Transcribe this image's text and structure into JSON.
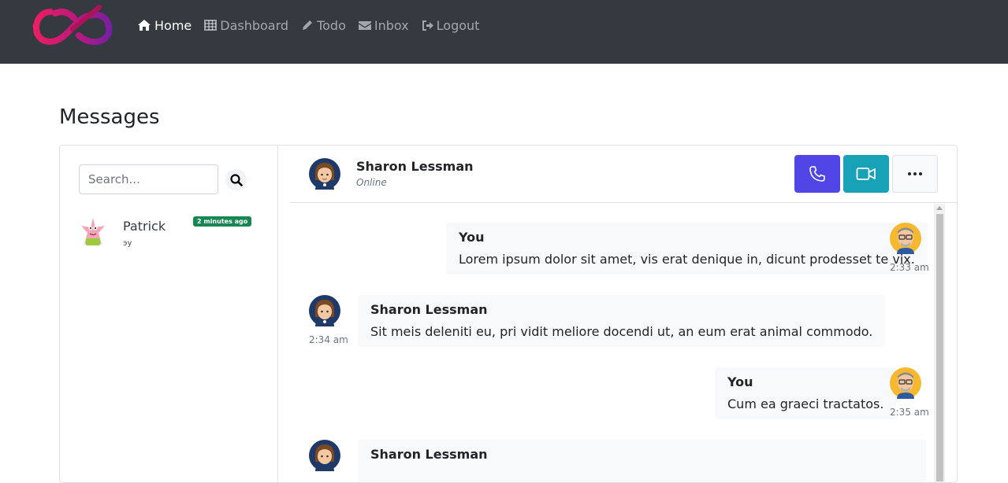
{
  "nav": {
    "items": [
      {
        "label": "Home",
        "icon": "home-icon",
        "active": true
      },
      {
        "label": "Dashboard",
        "icon": "table-icon",
        "active": false
      },
      {
        "label": "Todo",
        "icon": "pencil-icon",
        "active": false
      },
      {
        "label": "Inbox",
        "icon": "envelope-icon",
        "active": false
      },
      {
        "label": "Logout",
        "icon": "sign-out-icon",
        "active": false
      }
    ]
  },
  "page": {
    "title": "Messages"
  },
  "sidebar": {
    "search_placeholder": "Search...",
    "contacts": [
      {
        "name": "Patrick",
        "last_message": "эу",
        "badge": "2 minutes ago"
      }
    ]
  },
  "chat": {
    "contact_name": "Sharon Lessman",
    "contact_status": "Online",
    "messages": [
      {
        "sender": "You",
        "text": "Lorem ipsum dolor sit amet, vis erat denique in, dicunt prodesset te vix.",
        "time": "2:33 am",
        "side": "right"
      },
      {
        "sender": "Sharon Lessman",
        "text": "Sit meis deleniti eu, pri vidit meliore docendi ut, an eum erat animal commodo.",
        "time": "2:34 am",
        "side": "left"
      },
      {
        "sender": "You",
        "text": "Cum ea graeci tractatos.",
        "time": "2:35 am",
        "side": "right"
      },
      {
        "sender": "Sharon Lessman",
        "text": "",
        "time": "",
        "side": "left"
      }
    ]
  },
  "colors": {
    "navbar": "#343a40",
    "call_button": "#5046e5",
    "video_button": "#17a2b8",
    "badge": "#198754"
  }
}
